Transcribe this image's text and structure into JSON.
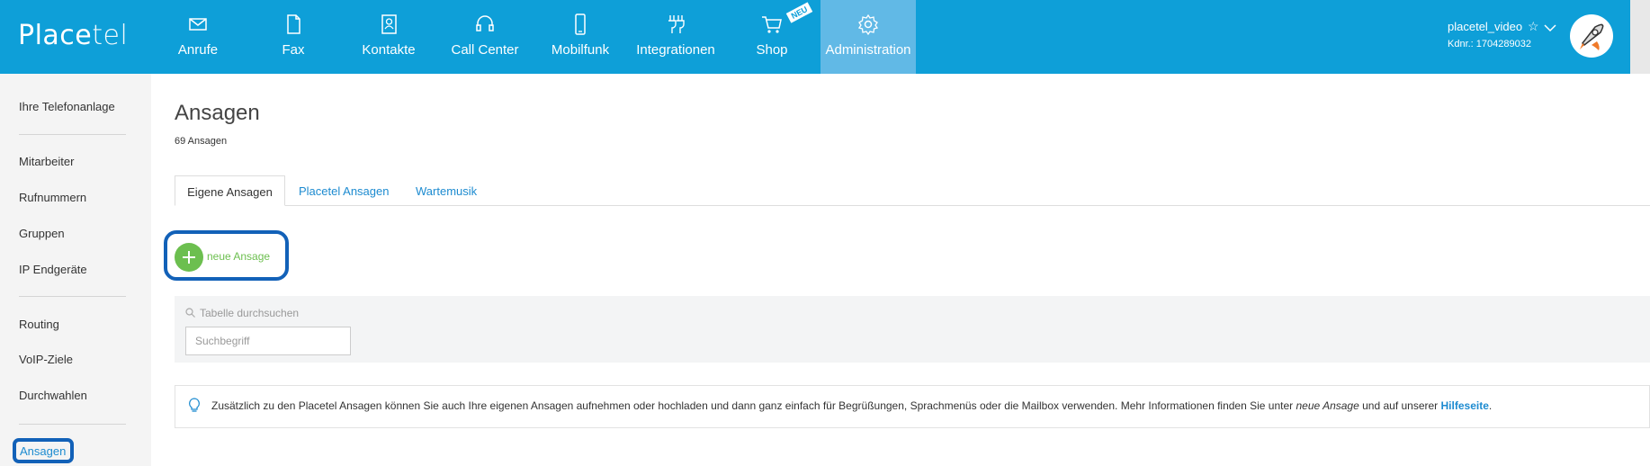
{
  "brand": {
    "logo_text_a": "Place",
    "logo_text_b": "tel"
  },
  "nav": [
    {
      "label": "Anrufe",
      "icon": "mail-icon"
    },
    {
      "label": "Fax",
      "icon": "document-icon"
    },
    {
      "label": "Kontakte",
      "icon": "contacts-icon"
    },
    {
      "label": "Call Center",
      "icon": "headset-icon"
    },
    {
      "label": "Mobilfunk",
      "icon": "mobile-icon"
    },
    {
      "label": "Integrationen",
      "icon": "plug-icon"
    },
    {
      "label": "Shop",
      "icon": "cart-icon",
      "badge": "NEU"
    },
    {
      "label": "Administration",
      "icon": "gear-icon",
      "active": true
    }
  ],
  "user": {
    "name": "placetel_video",
    "customer_number": "Kdnr.: 1704289032"
  },
  "sidebar": {
    "items": [
      "Ihre Telefonanlage",
      "Mitarbeiter",
      "Rufnummern",
      "Gruppen",
      "IP Endgeräte",
      "Routing",
      "VoIP-Ziele",
      "Durchwahlen",
      "Ansagen"
    ],
    "active": "Ansagen"
  },
  "main": {
    "title": "Ansagen",
    "count": "69 Ansagen",
    "tabs": [
      "Eigene Ansagen",
      "Placetel Ansagen",
      "Wartemusik"
    ],
    "new_button": "neue Ansage",
    "search_title": "Tabelle durchsuchen",
    "search_placeholder": "Suchbegriff",
    "info_text_1": "Zusätzlich zu den Placetel Ansagen können Sie auch Ihre eigenen Ansagen aufnehmen oder hochladen und dann ganz einfach für Begrüßungen, Sprachmenüs oder die Mailbox verwenden. Mehr Informationen finden Sie unter ",
    "info_em": "neue Ansage",
    "info_text_2": " und auf unserer ",
    "info_link": "Hilfeseite",
    "info_text_3": "."
  },
  "colors": {
    "topbar": "#0e9fd8",
    "active_nav": "#61b9e6",
    "accent_green": "#6cbf4f",
    "link": "#1d8bd0",
    "highlight": "#1261b8"
  }
}
